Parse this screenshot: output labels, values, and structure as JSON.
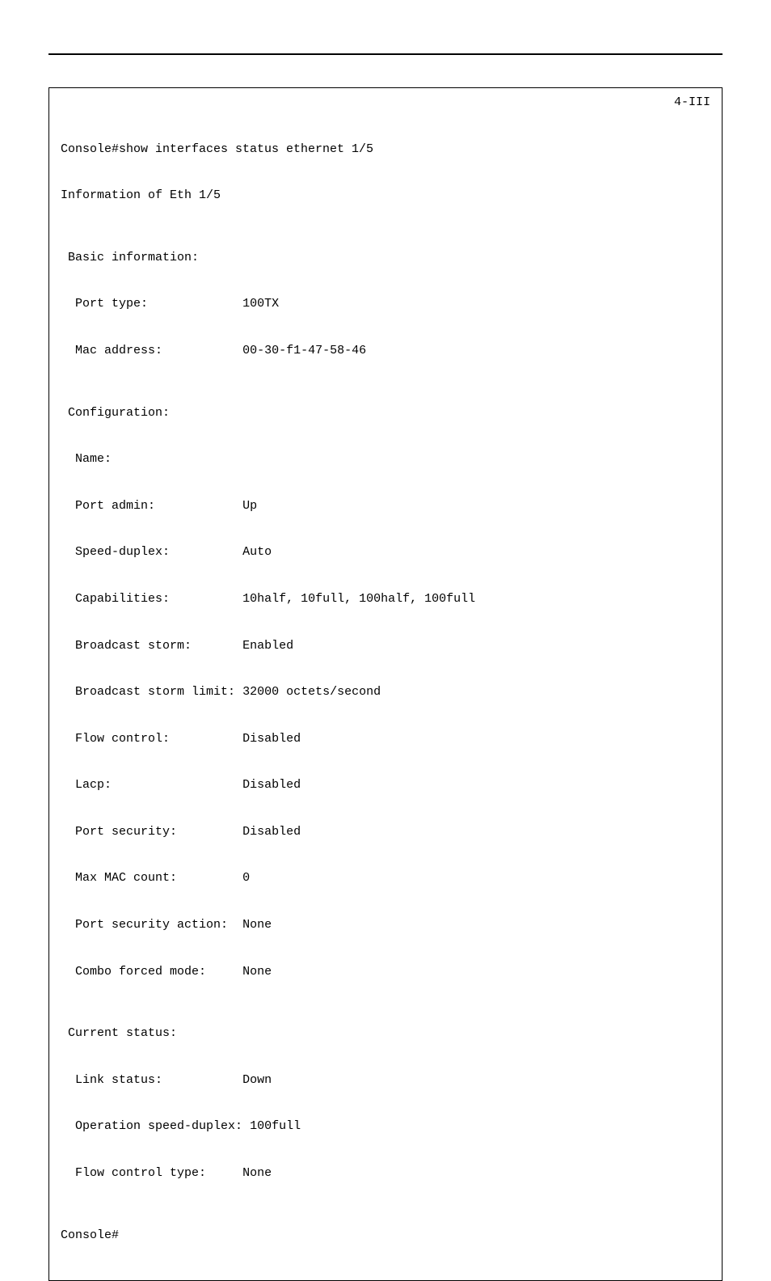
{
  "page_ref": "4-III",
  "cmd_line": "Console#show interfaces status ethernet 1/5",
  "title_line": "Information of Eth 1/5",
  "sections": {
    "basic_heading": " Basic information:",
    "basic": {
      "port_type_l": "  Port type:             ",
      "port_type_v": "100TX",
      "mac_l": "  Mac address:           ",
      "mac_v": "00-30-f1-47-58-46"
    },
    "config_heading": " Configuration:",
    "config": {
      "name_l": "  Name:",
      "name_v": "",
      "port_admin_l": "  Port admin:            ",
      "port_admin_v": "Up",
      "speed_duplex_l": "  Speed-duplex:          ",
      "speed_duplex_v": "Auto",
      "capabilities_l": "  Capabilities:          ",
      "capabilities_v": "10half, 10full, 100half, 100full",
      "bcast_l": "  Broadcast storm:       ",
      "bcast_v": "Enabled",
      "bcast_lim_l": "  Broadcast storm limit: ",
      "bcast_lim_v": "32000 octets/second",
      "flow_l": "  Flow control:          ",
      "flow_v": "Disabled",
      "lacp_l": "  Lacp:                  ",
      "lacp_v": "Disabled",
      "psec_l": "  Port security:         ",
      "psec_v": "Disabled",
      "maxmac_l": "  Max MAC count:         ",
      "maxmac_v": "0",
      "psec_act_l": "  Port security action:  ",
      "psec_act_v": "None",
      "combo_l": "  Combo forced mode:     ",
      "combo_v": "None"
    },
    "current_heading": " Current status:",
    "current": {
      "link_l": "  Link status:           ",
      "link_v": "Down",
      "opsd_l": "  Operation speed-duplex:",
      "opsd_v": " 100full",
      "flowtype_l": "  Flow control type:     ",
      "flowtype_v": "None"
    }
  },
  "prompt": "Console#"
}
